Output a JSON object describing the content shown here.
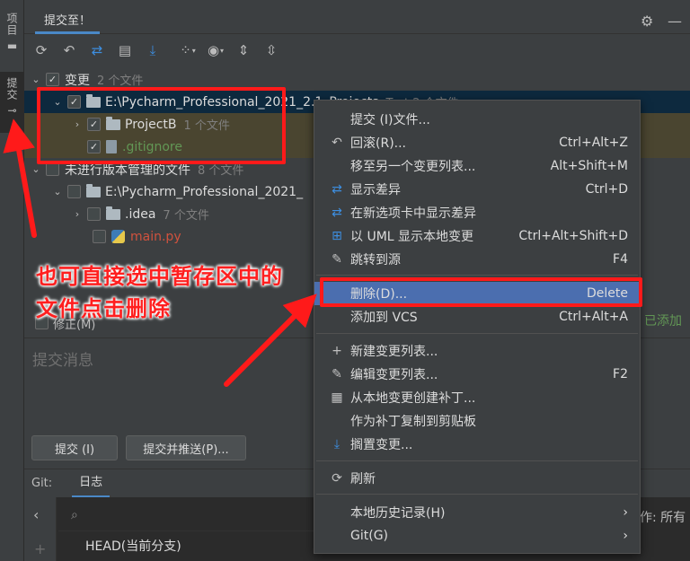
{
  "sidebar": {
    "project_label": "项目",
    "commit_label": "提交"
  },
  "tabs": {
    "commit_tab": "提交至！"
  },
  "toolbar": {
    "icons": [
      "refresh-icon",
      "rollback-icon",
      "show-diff-icon",
      "shelve-icon",
      "download-icon",
      "group-by-icon",
      "eye-icon",
      "expand-all-icon",
      "collapse-all-icon"
    ]
  },
  "tree": {
    "changes_label": "变更",
    "changes_count": "2 个文件",
    "path1": "E:\\Pycharm_Professional_2021_2.1_Projects",
    "path1_count": "Test  2 个文件",
    "projectb": "ProjectB",
    "projectb_count": "1 个文件",
    "gitignore": ".gitignore",
    "unversioned_label": "未进行版本管理的文件",
    "unversioned_count": "8 个文件",
    "path2": "E:\\Pycharm_Professional_2021_",
    "idea": ".idea",
    "idea_count": "7 个文件",
    "mainpy": "main.py"
  },
  "amend": {
    "label": "修正(M)",
    "right_status": "已添加"
  },
  "message": {
    "placeholder": "提交消息"
  },
  "buttons": {
    "commit": "提交 (I)",
    "commit_push": "提交并推送(P)..."
  },
  "git": {
    "label": "Git:",
    "log_tab": "日志",
    "head_label": "HEAD(当前分支)",
    "filter_all": "作: 所有"
  },
  "annotation": {
    "line1": "也可直接选中暂存区中的",
    "line2": "文件点击删除"
  },
  "menu": {
    "items": [
      {
        "label": "提交 (I)文件...",
        "shortcut": ""
      },
      {
        "label": "回滚(R)...",
        "shortcut": "Ctrl+Alt+Z"
      },
      {
        "label": "移至另一个变更列表...",
        "shortcut": "Alt+Shift+M"
      },
      {
        "label": "显示差异",
        "shortcut": "Ctrl+D"
      },
      {
        "label": "在新选项卡中显示差异",
        "shortcut": ""
      },
      {
        "label": "以 UML 显示本地变更",
        "shortcut": "Ctrl+Alt+Shift+D"
      },
      {
        "label": "跳转到源",
        "shortcut": "F4"
      },
      {
        "label": "删除(D)...",
        "shortcut": "Delete"
      },
      {
        "label": "添加到 VCS",
        "shortcut": "Ctrl+Alt+A"
      },
      {
        "label": "新建变更列表...",
        "shortcut": ""
      },
      {
        "label": "编辑变更列表...",
        "shortcut": "F2"
      },
      {
        "label": "从本地变更创建补丁...",
        "shortcut": ""
      },
      {
        "label": "作为补丁复制到剪贴板",
        "shortcut": ""
      },
      {
        "label": "搁置变更...",
        "shortcut": ""
      },
      {
        "label": "刷新",
        "shortcut": ""
      },
      {
        "label": "本地历史记录(H)",
        "shortcut": ""
      },
      {
        "label": "Git(G)",
        "shortcut": ""
      }
    ]
  },
  "colors": {
    "accent_blue": "#4a88c7",
    "annotation_red": "#ff1a1a",
    "green_added": "#629755",
    "red_unversioned": "#d0523e"
  }
}
